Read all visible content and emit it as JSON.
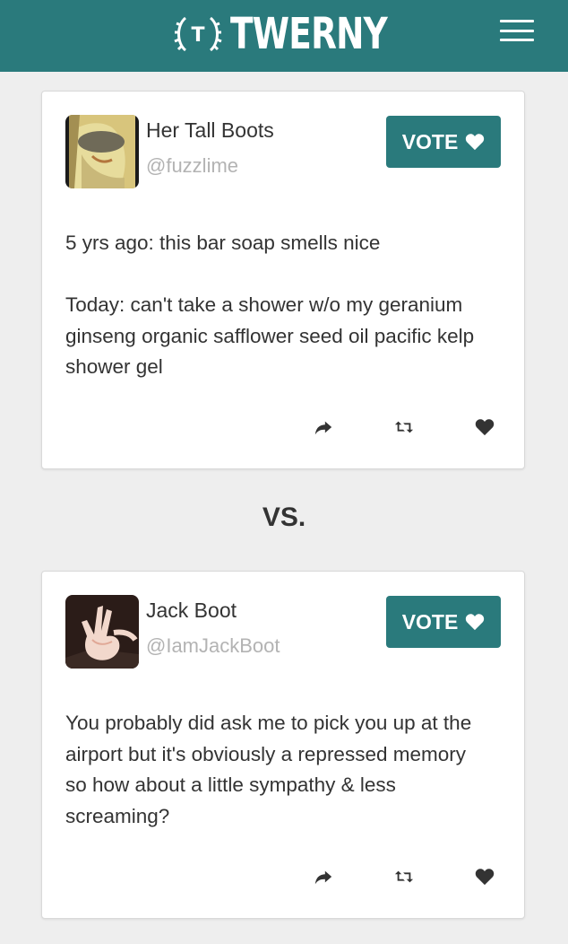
{
  "header": {
    "brand": "TWERNY",
    "logo_mark": "T",
    "bg_color": "#2a7a7c",
    "menu_icon": "hamburger-icon"
  },
  "tweets": [
    {
      "name": "Her Tall Boots",
      "handle": "@fuzzlime",
      "vote_label": "VOTE",
      "text": "5 yrs ago: this bar soap smells nice\n\nToday: can't take a shower w/o my geranium ginseng organic safflower seed oil pacific kelp shower gel",
      "actions": [
        "reply-icon",
        "retweet-icon",
        "favorite-icon"
      ]
    },
    {
      "name": "Jack Boot",
      "handle": "@IamJackBoot",
      "vote_label": "VOTE",
      "text": "You probably did ask me to pick you up at the airport but it's obviously a repressed memory so how about a little sympathy & less screaming?",
      "actions": [
        "reply-icon",
        "retweet-icon",
        "favorite-icon"
      ]
    }
  ],
  "versus_label": "VS.",
  "accent_color": "#2a7a7c"
}
